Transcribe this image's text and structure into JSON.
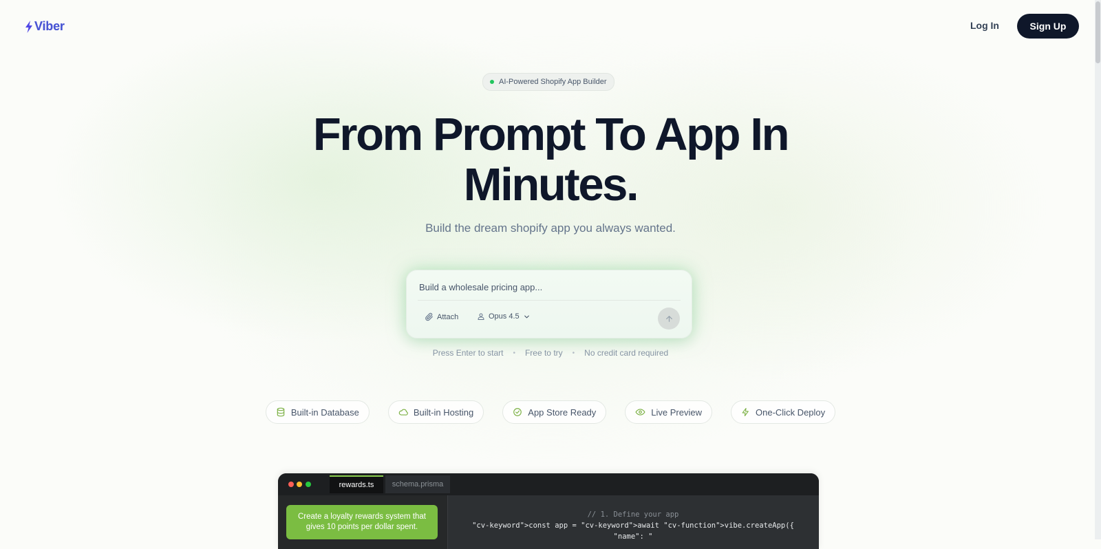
{
  "header": {
    "logo_text": "Viber",
    "login_label": "Log In",
    "signup_label": "Sign Up"
  },
  "hero": {
    "badge": "AI-Powered Shopify App Builder",
    "headline_line1": "From Prompt To App In",
    "headline_line2": "Minutes.",
    "subtitle": "Build the dream shopify app you always wanted."
  },
  "prompt": {
    "placeholder": "Build a wholesale pricing app...",
    "attach_label": "Attach",
    "model_label": "Opus 4.5"
  },
  "hints": [
    "Press Enter to start",
    "Free to try",
    "No credit card required"
  ],
  "features": [
    {
      "label": "Built-in Database",
      "icon": "database-icon"
    },
    {
      "label": "Built-in Hosting",
      "icon": "cloud-icon"
    },
    {
      "label": "App Store Ready",
      "icon": "check-circle-icon"
    },
    {
      "label": "Live Preview",
      "icon": "eye-icon"
    },
    {
      "label": "One-Click Deploy",
      "icon": "lightning-icon"
    }
  ],
  "editor": {
    "tabs": [
      "rewards.ts",
      "schema.prisma"
    ],
    "chat_message": "Create a loyalty rewards system that gives 10 points per dollar spent.",
    "code_lines": [
      "// 1. Define your app",
      "\"cv-keyword\">const app = \"cv-keyword\">await \"cv-function\">vibe.createApp({",
      "\"name\": \""
    ]
  },
  "colors": {
    "brand": "#4a56d4",
    "dark": "#0f172a",
    "accent_green": "#7bbd42",
    "status_dot": "#22c55e"
  }
}
